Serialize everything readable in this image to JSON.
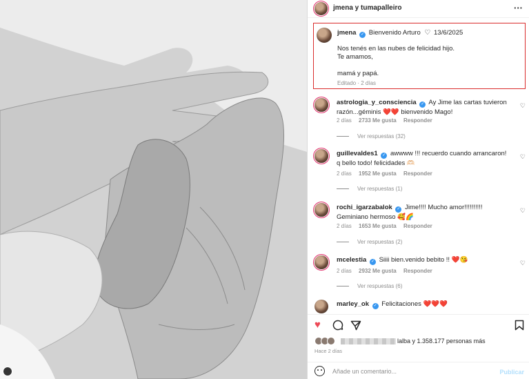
{
  "header": {
    "title": "jmena y tumapalleiro",
    "more_icon": "more-horizontal-icon"
  },
  "caption": {
    "username": "jmena",
    "text": "Bienvenido Arturo",
    "date": "13/6/2025",
    "body_lines": [
      "Nos tenés en las nubes de felicidad hijo.",
      "Te amamos,",
      "",
      "mamá y papá."
    ],
    "meta": "Editado · 2 días"
  },
  "comments": [
    {
      "username": "astrologia_y_consciencia",
      "text": "Ay Jime las cartas tuvieron razón...géminis ❤️❤️ bienvenido Mago!",
      "age": "2 días",
      "likes": "2733 Me gusta",
      "reply": "Responder",
      "replies": "Ver respuestas (32)"
    },
    {
      "username": "guillevaldes1",
      "text": "awwww !!! recuerdo cuando arrancaron! q bello todo! felicidades 🫶🏻",
      "age": "2 días",
      "likes": "1952 Me gusta",
      "reply": "Responder",
      "replies": "Ver respuestas (1)"
    },
    {
      "username": "rochi_igarzabalok",
      "text": "Jime!!!! Mucho amor!!!!!!!!!! Geminiano hermoso 🥰🌈",
      "age": "2 días",
      "likes": "1653 Me gusta",
      "reply": "Responder",
      "replies": "Ver respuestas (2)"
    },
    {
      "username": "mcelestia",
      "text": "Siiii bien.venido bebito !! ❤️😘",
      "age": "2 días",
      "likes": "2932 Me gusta",
      "reply": "Responder",
      "replies": "Ver respuestas (6)"
    },
    {
      "username": "marley_ok",
      "text": "Felicitaciones ❤️❤️❤️"
    }
  ],
  "likes": {
    "text": "lalba y 1.358.177 personas más"
  },
  "time_ago": "Hace 2 días",
  "comment_box": {
    "placeholder": "Añade un comentario...",
    "post_label": "Publicar"
  },
  "colors": {
    "like_red": "#ed4956",
    "verified_blue": "#3897f0",
    "highlight_box": "#d92b2b"
  }
}
